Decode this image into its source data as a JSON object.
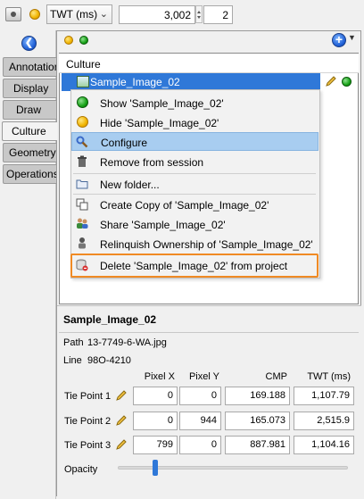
{
  "toolbar": {
    "unit_select": "TWT (ms)",
    "value1": "3,002",
    "value2": "2"
  },
  "tabs": [
    "Annotation",
    "Display",
    "Draw",
    "Culture",
    "Geometry",
    "Operations"
  ],
  "active_tab": "Culture",
  "culture": {
    "header": "Culture",
    "selected_row": "Sample_Image_02"
  },
  "menu": {
    "items": [
      {
        "label": "Show 'Sample_Image_02'",
        "icon": "green-dot-icon"
      },
      {
        "label": "Hide 'Sample_Image_02'",
        "icon": "yellow-dot-icon"
      },
      {
        "label": "Configure",
        "icon": "configure-icon"
      },
      {
        "label": "Remove from session",
        "icon": "trash-icon"
      },
      {
        "label": "New folder...",
        "icon": "folder-icon"
      },
      {
        "label": "Create Copy of 'Sample_Image_02'",
        "icon": "copy-icon"
      },
      {
        "label": "Share 'Sample_Image_02'",
        "icon": "share-users-icon"
      },
      {
        "label": "Relinquish Ownership of 'Sample_Image_02'",
        "icon": "relinquish-user-icon"
      },
      {
        "label": "Delete 'Sample_Image_02' from project",
        "icon": "delete-db-icon"
      }
    ]
  },
  "properties": {
    "title": "Sample_Image_02",
    "path_label": "Path",
    "path_value": "13-7749-6-WA.jpg",
    "line_label": "Line",
    "line_value": "98O-4210",
    "columns": [
      "Pixel X",
      "Pixel Y",
      "CMP",
      "TWT (ms)"
    ],
    "tie_points": [
      {
        "label": "Tie Point 1",
        "pixel_x": "0",
        "pixel_y": "0",
        "cmp": "169.188",
        "twt": "1,107.79"
      },
      {
        "label": "Tie Point 2",
        "pixel_x": "0",
        "pixel_y": "944",
        "cmp": "165.073",
        "twt": "2,515.9"
      },
      {
        "label": "Tie Point 3",
        "pixel_x": "799",
        "pixel_y": "0",
        "cmp": "887.981",
        "twt": "1,104.16"
      }
    ],
    "opacity_label": "Opacity",
    "opacity_fraction": 0.17
  },
  "colors": {
    "selection": "#2f78d8",
    "menu_hover": "#a8cdf0",
    "highlight_box": "#f08a24"
  }
}
